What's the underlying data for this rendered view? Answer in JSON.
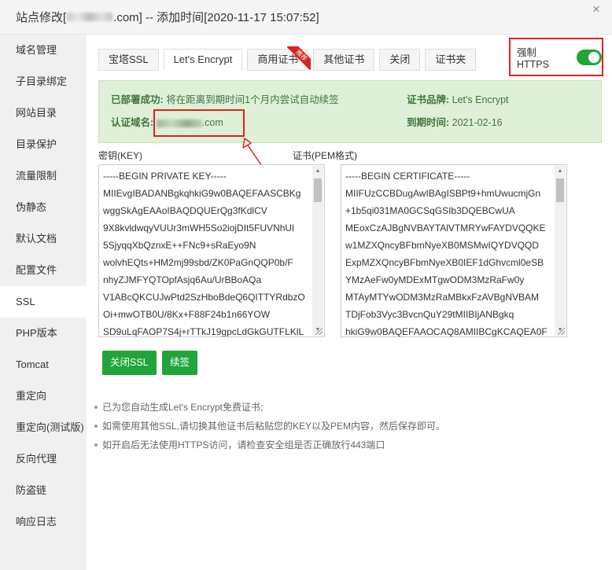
{
  "title": {
    "prefix": "站点修改[",
    "suffix": ".com] -- 添加时间[2020-11-17 15:07:52]"
  },
  "sidebar": {
    "items": [
      {
        "label": "域名管理"
      },
      {
        "label": "子目录绑定"
      },
      {
        "label": "网站目录"
      },
      {
        "label": "目录保护"
      },
      {
        "label": "流量限制"
      },
      {
        "label": "伪静态"
      },
      {
        "label": "默认文档"
      },
      {
        "label": "配置文件"
      },
      {
        "label": "SSL",
        "active": true
      },
      {
        "label": "PHP版本"
      },
      {
        "label": "Tomcat"
      },
      {
        "label": "重定向"
      },
      {
        "label": "重定向(测试版)"
      },
      {
        "label": "反向代理"
      },
      {
        "label": "防盗链"
      },
      {
        "label": "响应日志"
      }
    ]
  },
  "tabs": [
    {
      "label": "宝塔SSL"
    },
    {
      "label": "Let's Encrypt",
      "active": true
    },
    {
      "label": "商用证书",
      "badge": "推荐"
    },
    {
      "label": "其他证书"
    },
    {
      "label": "关闭"
    },
    {
      "label": "证书夹"
    }
  ],
  "https": {
    "label": "强制HTTPS",
    "enabled": true
  },
  "info": {
    "deployed_key": "已部署成功:",
    "deployed_val": "将在距离到期时间1个月内尝试自动续签",
    "domain_key": "认证域名:",
    "domain_val": ".com",
    "brand_key": "证书品牌:",
    "brand_val": "Let's Encrypt",
    "expiry_key": "到期时间:",
    "expiry_val": "2021-02-16"
  },
  "key_label": "密钥(KEY)",
  "cert_label": "证书(PEM格式)",
  "key_lines": [
    "-----BEGIN PRIVATE KEY-----",
    "MIIEvgIBADANBgkqhkiG9w0BAQEFAASCBKg",
    "wggSkAgEAAoIBAQDQUErQg3fKdlCV",
    "9X8kvldwqyVUUr3mWH5So2iojDIt5FUVNhUl",
    "5SjyqqXbQznxE++FNc9+sRaEyo9N",
    "wolvhEQts+HM2mj99sbd/ZK0PaGnQQP0b/F",
    "nhyZJMFYQTOpfAsjq6Au/UrBBoAQa",
    "V1ABcQKCUJwPtd2SzHboBdeQ6QITTYRdbzO",
    "Oi+mwOTB0U/8Kx+F88F24b1n66YOW",
    "SD9uLqFAOP7S4j+rTTkJ19gpcLdGkGUTFLKlL"
  ],
  "cert_lines": [
    "-----BEGIN CERTIFICATE-----",
    "MIIFUzCCBDugAwIBAgISBPt9+hmUwucmjGn",
    "+1b5qi031MA0GCSqGSIb3DQEBCwUA",
    "MEoxCzAJBgNVBAYTAlVTMRYwFAYDVQQKE",
    "w1MZXQncyBFbmNyeXB0MSMwIQYDVQQD",
    "ExpMZXQncyBFbmNyeXB0IEF1dGhvcml0eSB",
    "YMzAeFw0yMDExMTgwODM3MzRaFw0y",
    "MTAyMTYwODM3MzRaMBkxFzAVBgNVBAM",
    "TDjFob3Vyc3BvcnQuY29tMIIBIjANBgkq",
    "hkiG9w0BAQEFAAOCAQ8AMIIBCgKCAQEA0F"
  ],
  "buttons": {
    "close_ssl": "关闭SSL",
    "renew": "续签"
  },
  "tips": [
    "已为您自动生成Let's Encrypt免费证书;",
    "如需使用其他SSL,请切换其他证书后粘贴您的KEY以及PEM内容，然后保存即可。",
    "如开启后无法使用HTTPS访问，请检查安全组是否正确放行443端口"
  ],
  "colors": {
    "accent": "#20a53a",
    "alert_bg": "#dff0d8",
    "highlight": "#e02020"
  }
}
